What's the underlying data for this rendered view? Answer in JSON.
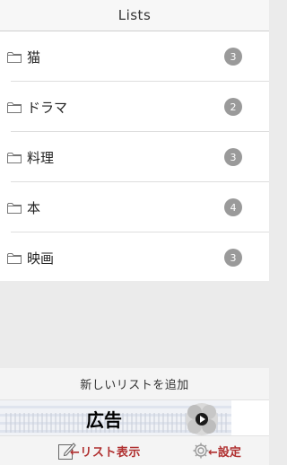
{
  "navbar": {
    "title": "Lists"
  },
  "lists": [
    {
      "label": "猫",
      "count": "3"
    },
    {
      "label": "ドラマ",
      "count": "2"
    },
    {
      "label": "料理",
      "count": "3"
    },
    {
      "label": "本",
      "count": "4"
    },
    {
      "label": "映画",
      "count": "3"
    }
  ],
  "add_button": {
    "label": "新しいリストを追加"
  },
  "ad": {
    "label": "広告"
  },
  "toolbar": {
    "list_view_label": "←リスト表示",
    "settings_label": "←設定"
  },
  "colors": {
    "badge": "#9a9a9a",
    "annotation": "#b03030"
  }
}
